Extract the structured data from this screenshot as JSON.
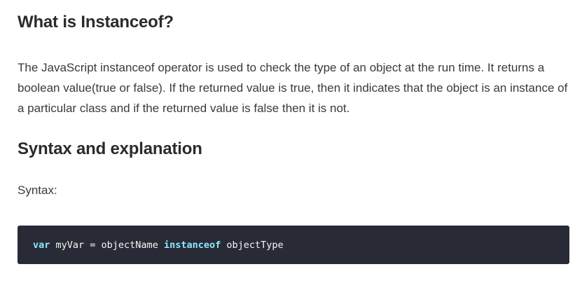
{
  "article": {
    "heading_1": "What is Instanceof?",
    "paragraph": "The JavaScript instanceof operator is used to check the type of an object at the run time. It returns a boolean value(true or false). If the returned value is true, then it indicates that the object is an instance of a particular class and if the returned value is false then it is not.",
    "heading_2": "Syntax and explanation",
    "syntax_label": "Syntax:",
    "code": {
      "kw_var": "var",
      "part_1": " myVar = objectName ",
      "kw_instanceof": "instanceof",
      "part_2": " objectType"
    }
  },
  "colors": {
    "code_background": "#282a36",
    "keyword": "#8be9fd",
    "code_text": "#f8f8f2"
  }
}
